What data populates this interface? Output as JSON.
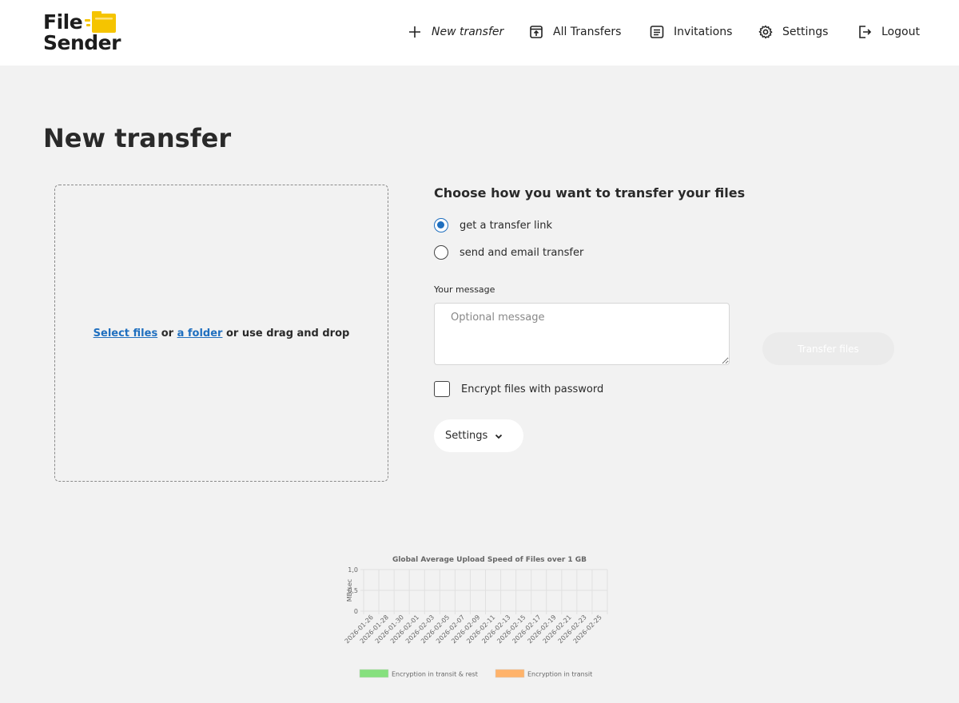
{
  "logo": {
    "line1": "File",
    "line2": "Sender",
    "accent": "#f5c400"
  },
  "nav": [
    {
      "id": "new",
      "label": "New transfer",
      "icon": "plus-icon",
      "italic": true
    },
    {
      "id": "all",
      "label": "All Transfers",
      "icon": "upload-box-icon"
    },
    {
      "id": "inv",
      "label": "Invitations",
      "icon": "list-icon"
    },
    {
      "id": "set",
      "label": "Settings",
      "icon": "gear-icon"
    },
    {
      "id": "out",
      "label": "Logout",
      "icon": "logout-icon"
    }
  ],
  "page": {
    "title": "New transfer"
  },
  "dropzone": {
    "select_files": "Select files",
    "or1": " or ",
    "a_folder": "a folder",
    "rest": " or use drag and drop"
  },
  "transfer": {
    "choose_title": "Choose how you want to transfer your files",
    "options": [
      {
        "label": "get a transfer link",
        "checked": true
      },
      {
        "label": "send and email transfer",
        "checked": false
      }
    ],
    "message_label": "Your message",
    "message_placeholder": "Optional message",
    "message_value": "",
    "transfer_button": "Transfer files",
    "encrypt_label": "Encrypt files with password",
    "encrypt_checked": false,
    "settings_button": "Settings"
  },
  "colors": {
    "link": "#1f6fbf",
    "radio": "#1f6fbf"
  },
  "chart_data": {
    "type": "bar",
    "title": "Global Average Upload Speed of Files over 1 GB",
    "ylabel": "MB/sec",
    "xlabel": "",
    "ylim": [
      0,
      1
    ],
    "y_ticks": [
      "0",
      "0,5",
      "1,0"
    ],
    "categories": [
      "2026-01-26",
      "2026-01-28",
      "2026-01-30",
      "2026-02-01",
      "2026-02-03",
      "2026-02-05",
      "2026-02-07",
      "2026-02-09",
      "2026-02-11",
      "2026-02-13",
      "2026-02-15",
      "2026-02-17",
      "2026-02-19",
      "2026-02-21",
      "2026-02-23",
      "2026-02-25"
    ],
    "series": [
      {
        "name": "Encryption in transit & rest",
        "color": "#86e07e",
        "values": []
      },
      {
        "name": "Encryption in transit",
        "color": "#ffb36b",
        "values": []
      }
    ],
    "grid": true,
    "legend": "bottom"
  }
}
